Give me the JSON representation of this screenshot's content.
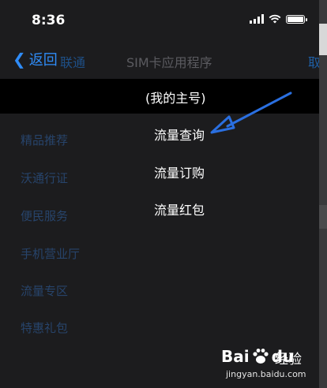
{
  "status_bar": {
    "time": "8:36"
  },
  "nav": {
    "back_label": "返回",
    "back_carrier": "联通",
    "title": "SIM卡应用程序",
    "cancel_label": "取消"
  },
  "primary_row": {
    "label": "(我的主号)"
  },
  "background_menu": {
    "items": [
      {
        "label": "精品推荐"
      },
      {
        "label": "沃通行证"
      },
      {
        "label": "便民服务"
      },
      {
        "label": "手机营业厅"
      },
      {
        "label": "流量专区"
      },
      {
        "label": "特惠礼包"
      }
    ]
  },
  "submenu": {
    "items": [
      {
        "label": "流量查询"
      },
      {
        "label": "流量订购"
      },
      {
        "label": "流量红包"
      }
    ]
  },
  "watermark": {
    "logo_left": "Bai",
    "logo_right": "du",
    "brand": "经验",
    "url": "jingyan.baidu.com"
  },
  "colors": {
    "accent_blue": "#2f8cf7",
    "annotation_arrow": "#2a6fe0",
    "background": "#1c1c1e"
  }
}
